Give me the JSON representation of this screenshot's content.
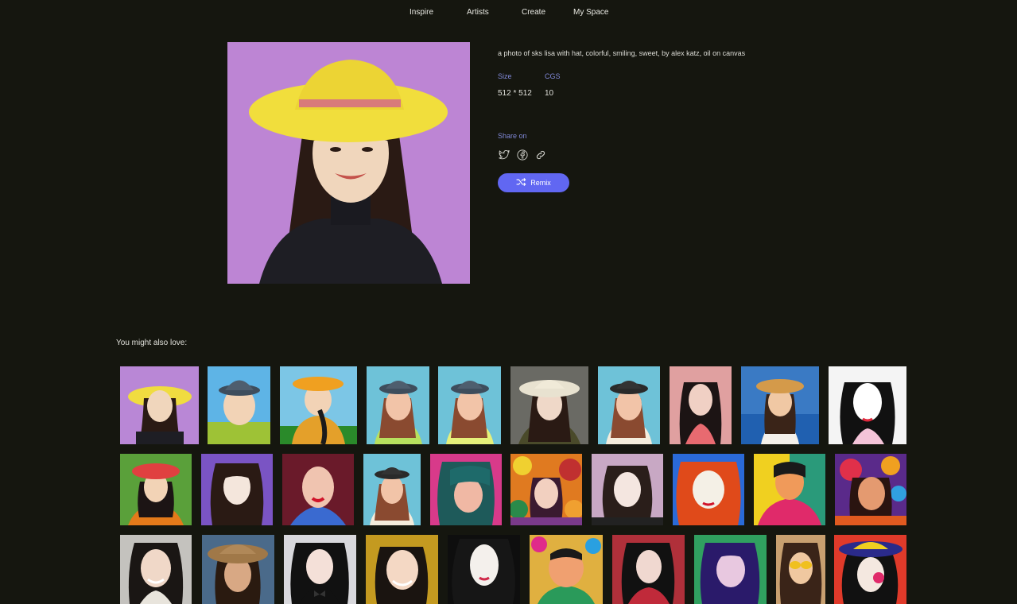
{
  "nav": {
    "items": [
      "Inspire",
      "Artists",
      "Create",
      "My Space"
    ]
  },
  "artwork": {
    "prompt": "a photo of sks lisa with hat, colorful, smiling, sweet, by alex katz, oil on canvas",
    "size_label": "Size",
    "size_value": "512 * 512",
    "cgs_label": "CGS",
    "cgs_value": "10",
    "share_label": "Share on",
    "share_icons": [
      "twitter-icon",
      "facebook-icon",
      "link-icon"
    ],
    "remix_label": "Remix"
  },
  "recommendations": {
    "heading": "You might also love:"
  },
  "colors": {
    "background": "#15160f",
    "accent": "#6167f2",
    "label": "#8088d8"
  }
}
